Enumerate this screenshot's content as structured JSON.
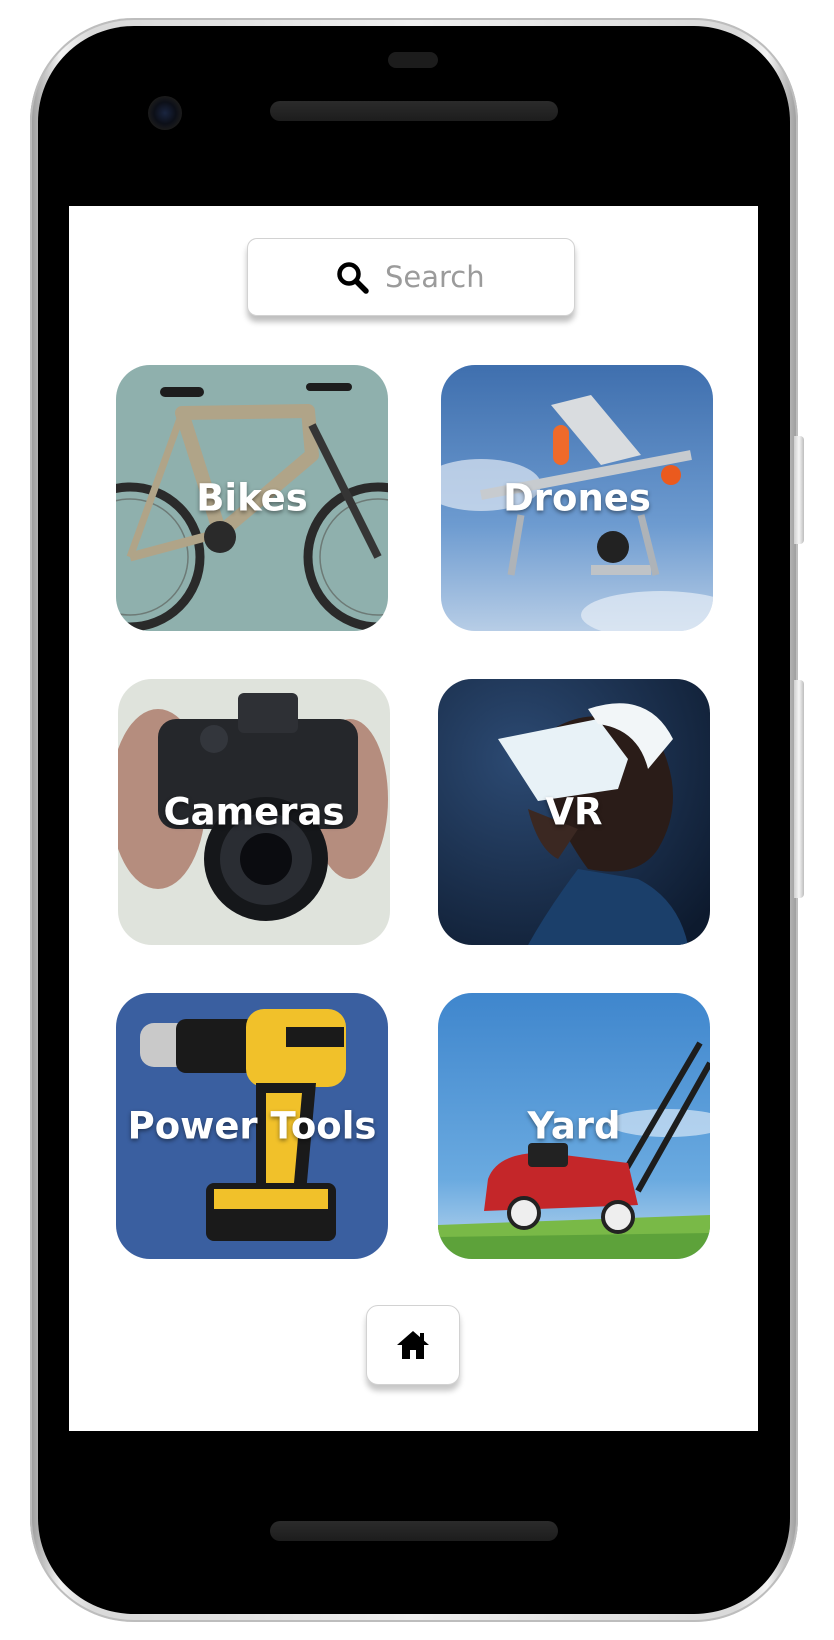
{
  "search": {
    "placeholder": "Search",
    "icon": "search-icon"
  },
  "categories": [
    {
      "label": "Bikes",
      "image": "mountain-bike-photo",
      "bg": "#8fb0ad"
    },
    {
      "label": "Drones",
      "image": "quadcopter-drone-photo",
      "bg": "#5a86bd"
    },
    {
      "label": "Cameras",
      "image": "dslr-camera-photo",
      "bg": "#dfe3dc"
    },
    {
      "label": "VR",
      "image": "vr-headset-photo",
      "bg": "#142540"
    },
    {
      "label": "Power Tools",
      "image": "cordless-drill-photo",
      "bg": "#3a5fa0"
    },
    {
      "label": "Yard",
      "image": "lawn-mower-photo",
      "bg": "#4f96d6"
    }
  ],
  "nav": {
    "home_icon": "home-icon"
  },
  "colors": {
    "label_text": "#ffffff",
    "screen_bg": "#ffffff",
    "device_bezel": "#000000"
  }
}
